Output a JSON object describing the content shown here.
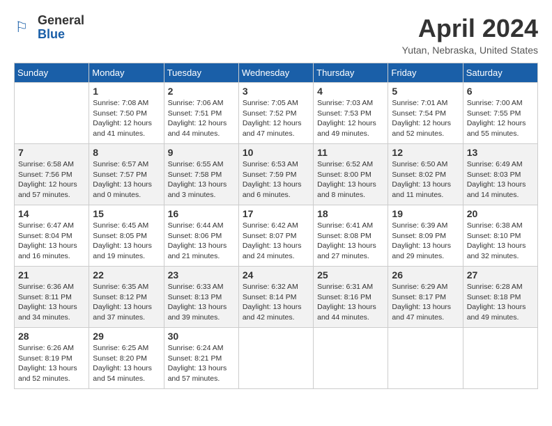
{
  "header": {
    "logo": {
      "general": "General",
      "blue": "Blue"
    },
    "title": "April 2024",
    "location": "Yutan, Nebraska, United States"
  },
  "days_of_week": [
    "Sunday",
    "Monday",
    "Tuesday",
    "Wednesday",
    "Thursday",
    "Friday",
    "Saturday"
  ],
  "weeks": [
    [
      {
        "day": "",
        "info": ""
      },
      {
        "day": "1",
        "info": "Sunrise: 7:08 AM\nSunset: 7:50 PM\nDaylight: 12 hours\nand 41 minutes."
      },
      {
        "day": "2",
        "info": "Sunrise: 7:06 AM\nSunset: 7:51 PM\nDaylight: 12 hours\nand 44 minutes."
      },
      {
        "day": "3",
        "info": "Sunrise: 7:05 AM\nSunset: 7:52 PM\nDaylight: 12 hours\nand 47 minutes."
      },
      {
        "day": "4",
        "info": "Sunrise: 7:03 AM\nSunset: 7:53 PM\nDaylight: 12 hours\nand 49 minutes."
      },
      {
        "day": "5",
        "info": "Sunrise: 7:01 AM\nSunset: 7:54 PM\nDaylight: 12 hours\nand 52 minutes."
      },
      {
        "day": "6",
        "info": "Sunrise: 7:00 AM\nSunset: 7:55 PM\nDaylight: 12 hours\nand 55 minutes."
      }
    ],
    [
      {
        "day": "7",
        "info": "Sunrise: 6:58 AM\nSunset: 7:56 PM\nDaylight: 12 hours\nand 57 minutes."
      },
      {
        "day": "8",
        "info": "Sunrise: 6:57 AM\nSunset: 7:57 PM\nDaylight: 13 hours\nand 0 minutes."
      },
      {
        "day": "9",
        "info": "Sunrise: 6:55 AM\nSunset: 7:58 PM\nDaylight: 13 hours\nand 3 minutes."
      },
      {
        "day": "10",
        "info": "Sunrise: 6:53 AM\nSunset: 7:59 PM\nDaylight: 13 hours\nand 6 minutes."
      },
      {
        "day": "11",
        "info": "Sunrise: 6:52 AM\nSunset: 8:00 PM\nDaylight: 13 hours\nand 8 minutes."
      },
      {
        "day": "12",
        "info": "Sunrise: 6:50 AM\nSunset: 8:02 PM\nDaylight: 13 hours\nand 11 minutes."
      },
      {
        "day": "13",
        "info": "Sunrise: 6:49 AM\nSunset: 8:03 PM\nDaylight: 13 hours\nand 14 minutes."
      }
    ],
    [
      {
        "day": "14",
        "info": "Sunrise: 6:47 AM\nSunset: 8:04 PM\nDaylight: 13 hours\nand 16 minutes."
      },
      {
        "day": "15",
        "info": "Sunrise: 6:45 AM\nSunset: 8:05 PM\nDaylight: 13 hours\nand 19 minutes."
      },
      {
        "day": "16",
        "info": "Sunrise: 6:44 AM\nSunset: 8:06 PM\nDaylight: 13 hours\nand 21 minutes."
      },
      {
        "day": "17",
        "info": "Sunrise: 6:42 AM\nSunset: 8:07 PM\nDaylight: 13 hours\nand 24 minutes."
      },
      {
        "day": "18",
        "info": "Sunrise: 6:41 AM\nSunset: 8:08 PM\nDaylight: 13 hours\nand 27 minutes."
      },
      {
        "day": "19",
        "info": "Sunrise: 6:39 AM\nSunset: 8:09 PM\nDaylight: 13 hours\nand 29 minutes."
      },
      {
        "day": "20",
        "info": "Sunrise: 6:38 AM\nSunset: 8:10 PM\nDaylight: 13 hours\nand 32 minutes."
      }
    ],
    [
      {
        "day": "21",
        "info": "Sunrise: 6:36 AM\nSunset: 8:11 PM\nDaylight: 13 hours\nand 34 minutes."
      },
      {
        "day": "22",
        "info": "Sunrise: 6:35 AM\nSunset: 8:12 PM\nDaylight: 13 hours\nand 37 minutes."
      },
      {
        "day": "23",
        "info": "Sunrise: 6:33 AM\nSunset: 8:13 PM\nDaylight: 13 hours\nand 39 minutes."
      },
      {
        "day": "24",
        "info": "Sunrise: 6:32 AM\nSunset: 8:14 PM\nDaylight: 13 hours\nand 42 minutes."
      },
      {
        "day": "25",
        "info": "Sunrise: 6:31 AM\nSunset: 8:16 PM\nDaylight: 13 hours\nand 44 minutes."
      },
      {
        "day": "26",
        "info": "Sunrise: 6:29 AM\nSunset: 8:17 PM\nDaylight: 13 hours\nand 47 minutes."
      },
      {
        "day": "27",
        "info": "Sunrise: 6:28 AM\nSunset: 8:18 PM\nDaylight: 13 hours\nand 49 minutes."
      }
    ],
    [
      {
        "day": "28",
        "info": "Sunrise: 6:26 AM\nSunset: 8:19 PM\nDaylight: 13 hours\nand 52 minutes."
      },
      {
        "day": "29",
        "info": "Sunrise: 6:25 AM\nSunset: 8:20 PM\nDaylight: 13 hours\nand 54 minutes."
      },
      {
        "day": "30",
        "info": "Sunrise: 6:24 AM\nSunset: 8:21 PM\nDaylight: 13 hours\nand 57 minutes."
      },
      {
        "day": "",
        "info": ""
      },
      {
        "day": "",
        "info": ""
      },
      {
        "day": "",
        "info": ""
      },
      {
        "day": "",
        "info": ""
      }
    ]
  ]
}
